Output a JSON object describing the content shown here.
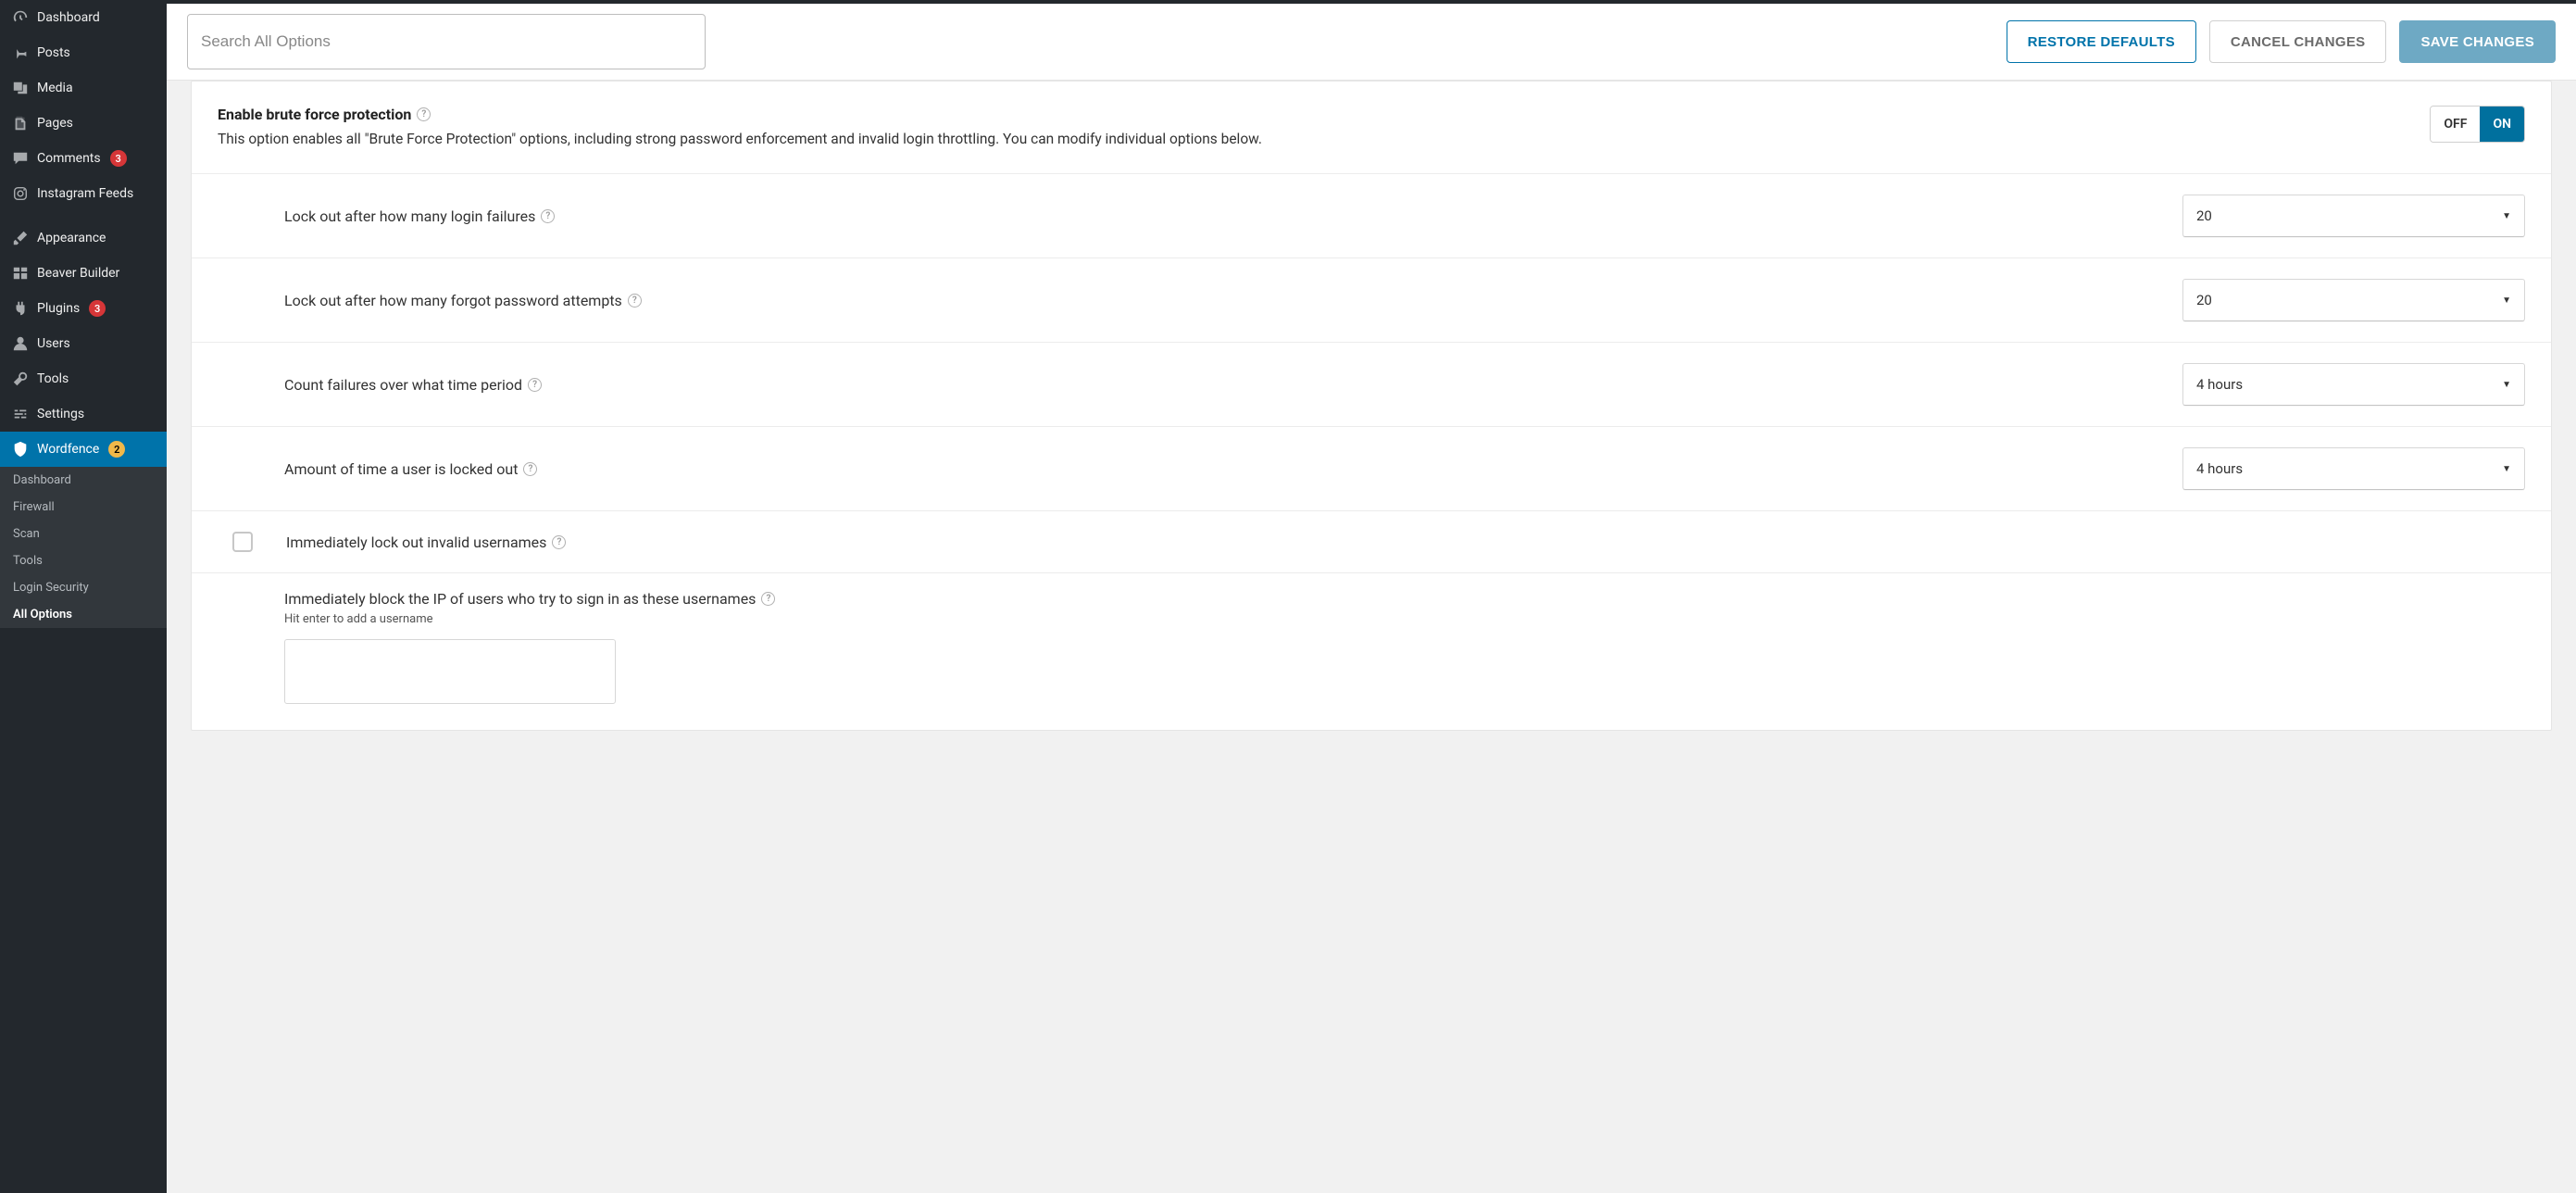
{
  "search": {
    "placeholder": "Search All Options"
  },
  "buttons": {
    "restore": "RESTORE DEFAULTS",
    "cancel": "CANCEL CHANGES",
    "save": "SAVE CHANGES"
  },
  "sidebar": {
    "items": [
      {
        "label": "Dashboard"
      },
      {
        "label": "Posts"
      },
      {
        "label": "Media"
      },
      {
        "label": "Pages"
      },
      {
        "label": "Comments",
        "badge": "3",
        "badge_color": "red"
      },
      {
        "label": "Instagram Feeds"
      },
      {
        "label": "Appearance"
      },
      {
        "label": "Beaver Builder"
      },
      {
        "label": "Plugins",
        "badge": "3",
        "badge_color": "red"
      },
      {
        "label": "Users"
      },
      {
        "label": "Tools"
      },
      {
        "label": "Settings"
      },
      {
        "label": "Wordfence",
        "badge": "2",
        "badge_color": "yellow",
        "active": true
      }
    ],
    "submenu": [
      "Dashboard",
      "Firewall",
      "Scan",
      "Tools",
      "Login Security",
      "All Options"
    ],
    "submenu_current": "All Options"
  },
  "brute_force": {
    "title": "Enable brute force protection",
    "desc": "This option enables all \"Brute Force Protection\" options, including strong password enforcement and invalid login throttling. You can modify individual options below.",
    "toggle": {
      "off": "OFF",
      "on": "ON",
      "value": "ON"
    },
    "options": [
      {
        "label": "Lock out after how many login failures",
        "value": "20"
      },
      {
        "label": "Lock out after how many forgot password attempts",
        "value": "20"
      },
      {
        "label": "Count failures over what time period",
        "value": "4 hours"
      },
      {
        "label": "Amount of time a user is locked out",
        "value": "4 hours"
      }
    ],
    "checkbox_label": "Immediately lock out invalid usernames",
    "block_ip": {
      "label": "Immediately block the IP of users who try to sign in as these usernames",
      "hint": "Hit enter to add a username"
    }
  }
}
